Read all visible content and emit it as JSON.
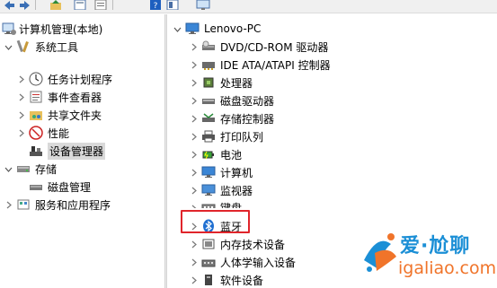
{
  "left_tree": {
    "root": "计算机管理(本地)",
    "system_tools": "系统工具",
    "task_scheduler": "任务计划程序",
    "event_viewer": "事件查看器",
    "shared_folders": "共享文件夹",
    "performance": "性能",
    "device_manager": "设备管理器",
    "storage": "存储",
    "disk_management": "磁盘管理",
    "services_apps": "服务和应用程序"
  },
  "right_tree": {
    "computer_name": "Lenovo-PC",
    "categories": [
      {
        "label": "DVD/CD-ROM 驱动器",
        "icon": "dvd-drive-icon"
      },
      {
        "label": "IDE ATA/ATAPI 控制器",
        "icon": "ide-controller-icon"
      },
      {
        "label": "处理器",
        "icon": "processor-icon"
      },
      {
        "label": "磁盘驱动器",
        "icon": "disk-drive-icon"
      },
      {
        "label": "存储控制器",
        "icon": "storage-controller-icon"
      },
      {
        "label": "打印队列",
        "icon": "printer-icon"
      },
      {
        "label": "电池",
        "icon": "battery-icon"
      },
      {
        "label": "计算机",
        "icon": "computer-icon"
      },
      {
        "label": "监视器",
        "icon": "monitor-icon"
      },
      {
        "label": "键盘",
        "icon": "keyboard-icon"
      },
      {
        "label": "蓝牙",
        "icon": "bluetooth-icon"
      },
      {
        "label": "内存技术设备",
        "icon": "memory-device-icon"
      },
      {
        "label": "人体学输入设备",
        "icon": "hid-icon"
      },
      {
        "label": "软件设备",
        "icon": "software-device-icon"
      }
    ]
  },
  "watermark": {
    "name": "爱·尬聊",
    "url": "igaliao.com",
    "colors": {
      "blue": "#1b8fd6",
      "orange": "#f0742a",
      "red": "#e0252b"
    }
  }
}
